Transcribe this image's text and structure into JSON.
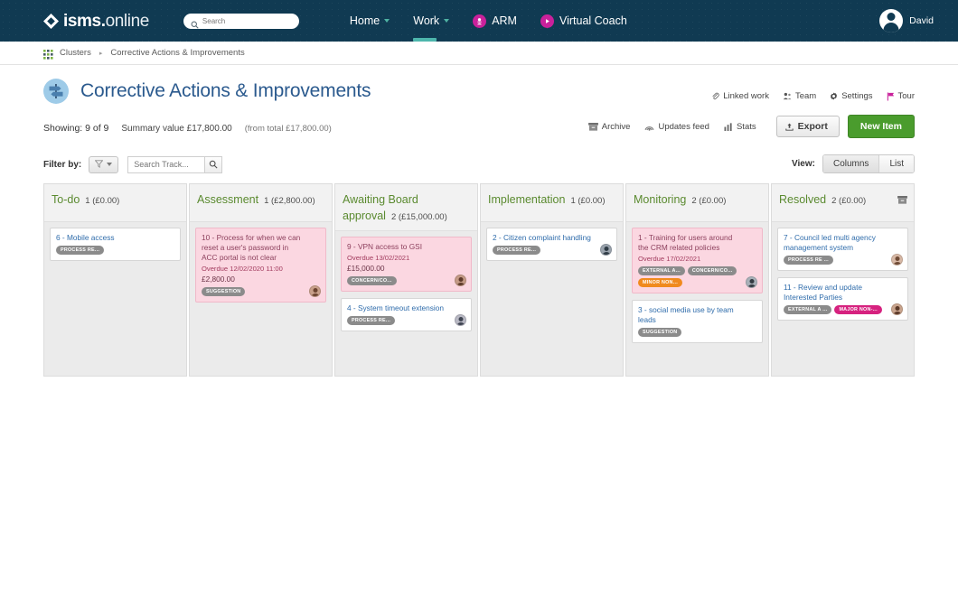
{
  "topnav": {
    "logo": {
      "bold": "isms.",
      "light": "online",
      "icon": "isms-diamond-logo"
    },
    "search_placeholder": "Search",
    "items": [
      {
        "label": "Home",
        "has_caret": true,
        "icon": null,
        "active": false
      },
      {
        "label": "Work",
        "has_caret": true,
        "icon": null,
        "active": true
      },
      {
        "label": "ARM",
        "has_caret": false,
        "icon": "arm-person-icon",
        "active": false
      },
      {
        "label": "Virtual Coach",
        "has_caret": false,
        "icon": "play-circle-icon",
        "active": false
      }
    ],
    "user": {
      "name": "David",
      "has_caret": true
    }
  },
  "breadcrumb": {
    "root": "Clusters",
    "separator": "▸",
    "current": "Corrective Actions & Improvements"
  },
  "header": {
    "title": "Corrective Actions & Improvements",
    "links": [
      {
        "label": "Linked work",
        "icon": "paperclip-icon"
      },
      {
        "label": "Team",
        "icon": "people-icon"
      },
      {
        "label": "Settings",
        "icon": "gear-icon"
      },
      {
        "label": "Tour",
        "icon": "flag-icon"
      }
    ]
  },
  "summary": {
    "showing": "Showing: 9 of 9",
    "summary_value": "Summary value £17,800.00",
    "from_total": "(from total £17,800.00)"
  },
  "actions": {
    "links": [
      {
        "label": "Archive",
        "icon": "archive-box-icon"
      },
      {
        "label": "Updates feed",
        "icon": "rss-feed-icon"
      },
      {
        "label": "Stats",
        "icon": "bar-chart-icon"
      }
    ],
    "export_label": "Export",
    "export_icon": "upload-icon",
    "new_item_label": "New Item"
  },
  "filters": {
    "filter_by_label": "Filter by:",
    "filter_icon": "funnel-icon",
    "search_placeholder": "Search Track...",
    "search_value": "",
    "search_icon": "search-icon",
    "view_label": "View:",
    "view_options": [
      "Columns",
      "List"
    ],
    "view_selected": "Columns"
  },
  "board": {
    "columns": [
      {
        "title": "To-do",
        "count": "1 (£0.00)",
        "has_archive_icon": false,
        "cards": [
          {
            "title": "6 - Mobile access",
            "overdue": false,
            "due": null,
            "value": null,
            "tags": [
              {
                "label": "PROCESS RE...",
                "color": "gray"
              }
            ],
            "avatar": null
          }
        ]
      },
      {
        "title": "Assessment",
        "count": "1 (£2,800.00)",
        "has_archive_icon": false,
        "cards": [
          {
            "title": "10 - Process for when we can reset a user's password in ACC portal is not clear",
            "overdue": true,
            "due": "Overdue 12/02/2020 11:00",
            "value": "£2,800.00",
            "tags": [
              {
                "label": "SUGGESTION",
                "color": "gray"
              }
            ],
            "avatar": "a1"
          }
        ]
      },
      {
        "title": "Awaiting Board approval",
        "count": "2 (£15,000.00)",
        "has_archive_icon": false,
        "cards": [
          {
            "title": "9 - VPN access to GSI",
            "overdue": true,
            "due": "Overdue 13/02/2021",
            "value": "£15,000.00",
            "tags": [
              {
                "label": "CONCERN/CO...",
                "color": "gray"
              }
            ],
            "avatar": "a3"
          },
          {
            "title": "4 - System timeout extension",
            "overdue": false,
            "due": null,
            "value": null,
            "tags": [
              {
                "label": "PROCESS RE...",
                "color": "gray"
              }
            ],
            "avatar": "a2"
          }
        ]
      },
      {
        "title": "Implementation",
        "count": "1 (£0.00)",
        "has_archive_icon": false,
        "cards": [
          {
            "title": "2 - Citizen complaint handling",
            "overdue": false,
            "due": null,
            "value": null,
            "tags": [
              {
                "label": "PROCESS RE...",
                "color": "gray"
              }
            ],
            "avatar": "a4"
          }
        ]
      },
      {
        "title": "Monitoring",
        "count": "2 (£0.00)",
        "has_archive_icon": false,
        "cards": [
          {
            "title": "1 - Training for users around the CRM related policies",
            "overdue": true,
            "due": "Overdue 17/02/2021",
            "value": null,
            "tags": [
              {
                "label": "EXTERNAL A...",
                "color": "gray"
              },
              {
                "label": "CONCERN/CO...",
                "color": "gray"
              },
              {
                "label": "MINOR NON...",
                "color": "orange"
              }
            ],
            "avatar": "a5"
          },
          {
            "title": "3 - social media use by team leads",
            "overdue": false,
            "due": null,
            "value": null,
            "tags": [
              {
                "label": "SUGGESTION",
                "color": "gray"
              }
            ],
            "avatar": null
          }
        ]
      },
      {
        "title": "Resolved",
        "count": "2 (£0.00)",
        "has_archive_icon": true,
        "cards": [
          {
            "title": "7 - Council led multi agency management system",
            "overdue": false,
            "due": null,
            "value": null,
            "tags": [
              {
                "label": "PROCESS RE ...",
                "color": "gray"
              }
            ],
            "avatar": "a6"
          },
          {
            "title": "11 - Review and update Interested Parties",
            "overdue": false,
            "due": null,
            "value": null,
            "tags": [
              {
                "label": "EXTERNAL A ...",
                "color": "gray"
              },
              {
                "label": "MAJOR NON-...",
                "color": "magenta"
              }
            ],
            "avatar": "a7"
          }
        ]
      }
    ]
  },
  "colors": {
    "nav_bg": "#103a52",
    "accent_teal": "#4db6ac",
    "accent_magenta": "#c9219b",
    "title_blue": "#2b5a8e",
    "column_title_green": "#5a8a2f",
    "new_item_green": "#4a9c2d",
    "overdue_pink": "#fbd7e1",
    "tag_gray": "#8b8b8b",
    "tag_orange": "#f08a1e",
    "tag_magenta": "#d6227f"
  }
}
